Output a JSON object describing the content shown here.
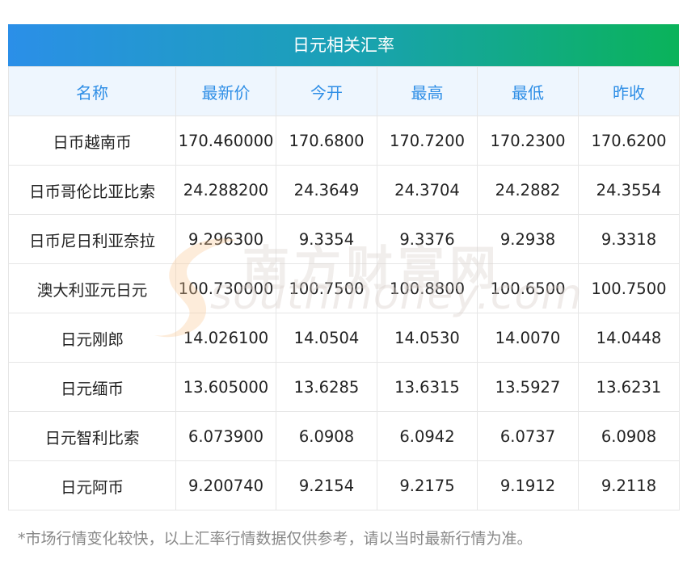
{
  "title": "日元相关汇率",
  "columns": [
    "名称",
    "最新价",
    "今开",
    "最高",
    "最低",
    "昨收"
  ],
  "rows": [
    [
      "日币越南币",
      "170.460000",
      "170.6800",
      "170.7200",
      "170.2300",
      "170.6200"
    ],
    [
      "日币哥伦比亚比索",
      "24.288200",
      "24.3649",
      "24.3704",
      "24.2882",
      "24.3554"
    ],
    [
      "日币尼日利亚奈拉",
      "9.296300",
      "9.3354",
      "9.3376",
      "9.2938",
      "9.3318"
    ],
    [
      "澳大利亚元日元",
      "100.730000",
      "100.7500",
      "100.8800",
      "100.6500",
      "100.7500"
    ],
    [
      "日元刚郎",
      "14.026100",
      "14.0504",
      "14.0530",
      "14.0070",
      "14.0448"
    ],
    [
      "日元缅币",
      "13.605000",
      "13.6285",
      "13.6315",
      "13.5927",
      "13.6231"
    ],
    [
      "日元智利比索",
      "6.073900",
      "6.0908",
      "6.0942",
      "6.0737",
      "6.0908"
    ],
    [
      "日元阿币",
      "9.200740",
      "9.2154",
      "9.2175",
      "9.1912",
      "9.2118"
    ]
  ],
  "watermark": {
    "cn": "南方财富网",
    "en": "southmoney.com"
  },
  "footnote": "*市场行情变化较快，以上汇率行情数据仅供参考，请以当时最新行情为准。",
  "colors": {
    "header_text": "#2e8ee6",
    "header_bg": "#eef6fe",
    "gradient_start": "#2b8fe8",
    "gradient_end": "#0ab35a"
  }
}
